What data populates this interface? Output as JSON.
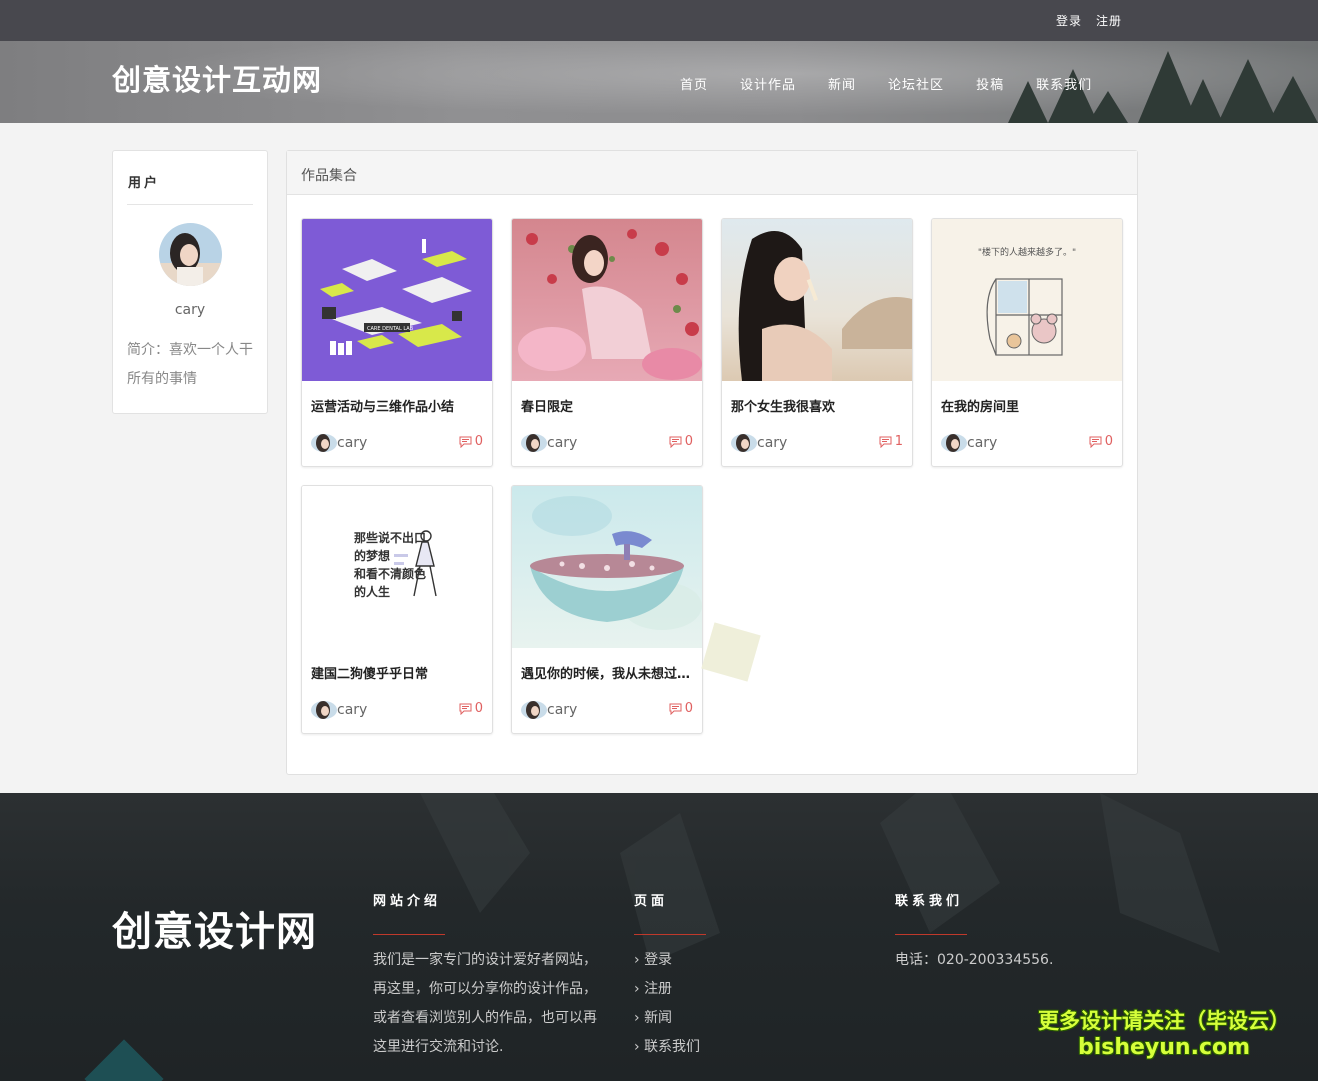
{
  "topbar": {
    "login": "登录",
    "register": "注册"
  },
  "header": {
    "logo": "创意设计互动网",
    "nav": [
      "首页",
      "设计作品",
      "新闻",
      "论坛社区",
      "投稿",
      "联系我们"
    ]
  },
  "sidebar": {
    "title": "用户",
    "username": "cary",
    "intro": "简介：喜欢一个人干所有的事情"
  },
  "panel": {
    "title": "作品集合",
    "works": [
      {
        "title": "运营活动与三维作品小结",
        "author": "cary",
        "comments": "0"
      },
      {
        "title": "春日限定",
        "author": "cary",
        "comments": "0"
      },
      {
        "title": "那个女生我很喜欢",
        "author": "cary",
        "comments": "1"
      },
      {
        "title": "在我的房间里",
        "author": "cary",
        "comments": "0"
      },
      {
        "title": "建国二狗傻乎乎日常",
        "author": "cary",
        "comments": "0"
      },
      {
        "title": "遇见你的时候，我从未想过……",
        "author": "cary",
        "comments": "0"
      }
    ],
    "thumb_text": {
      "work1": "CARE DENTAL LAB",
      "work4": "\"楼下的人越来越多了。\"",
      "work5": [
        "那些说不出口",
        "的梦想",
        "和看不清颜色",
        "的人生"
      ]
    }
  },
  "footer": {
    "logo": "创意设计网",
    "about": {
      "heading": "网站介绍",
      "text": "我们是一家专门的设计爱好者网站，再这里，你可以分享你的设计作品，或者查看浏览别人的作品，也可以再这里进行交流和讨论."
    },
    "pages": {
      "heading": "页面",
      "links": [
        "登录",
        "注册",
        "新闻",
        "联系我们"
      ]
    },
    "contact": {
      "heading": "联系我们",
      "phone": "电话：020-200334556."
    },
    "watermark": {
      "line1": "更多设计请关注（毕设云）",
      "line2": "bisheyun.com"
    }
  },
  "colors": {
    "accent": "#c0392b",
    "comment": "#e06060",
    "watermark": "#d6ff3a"
  }
}
